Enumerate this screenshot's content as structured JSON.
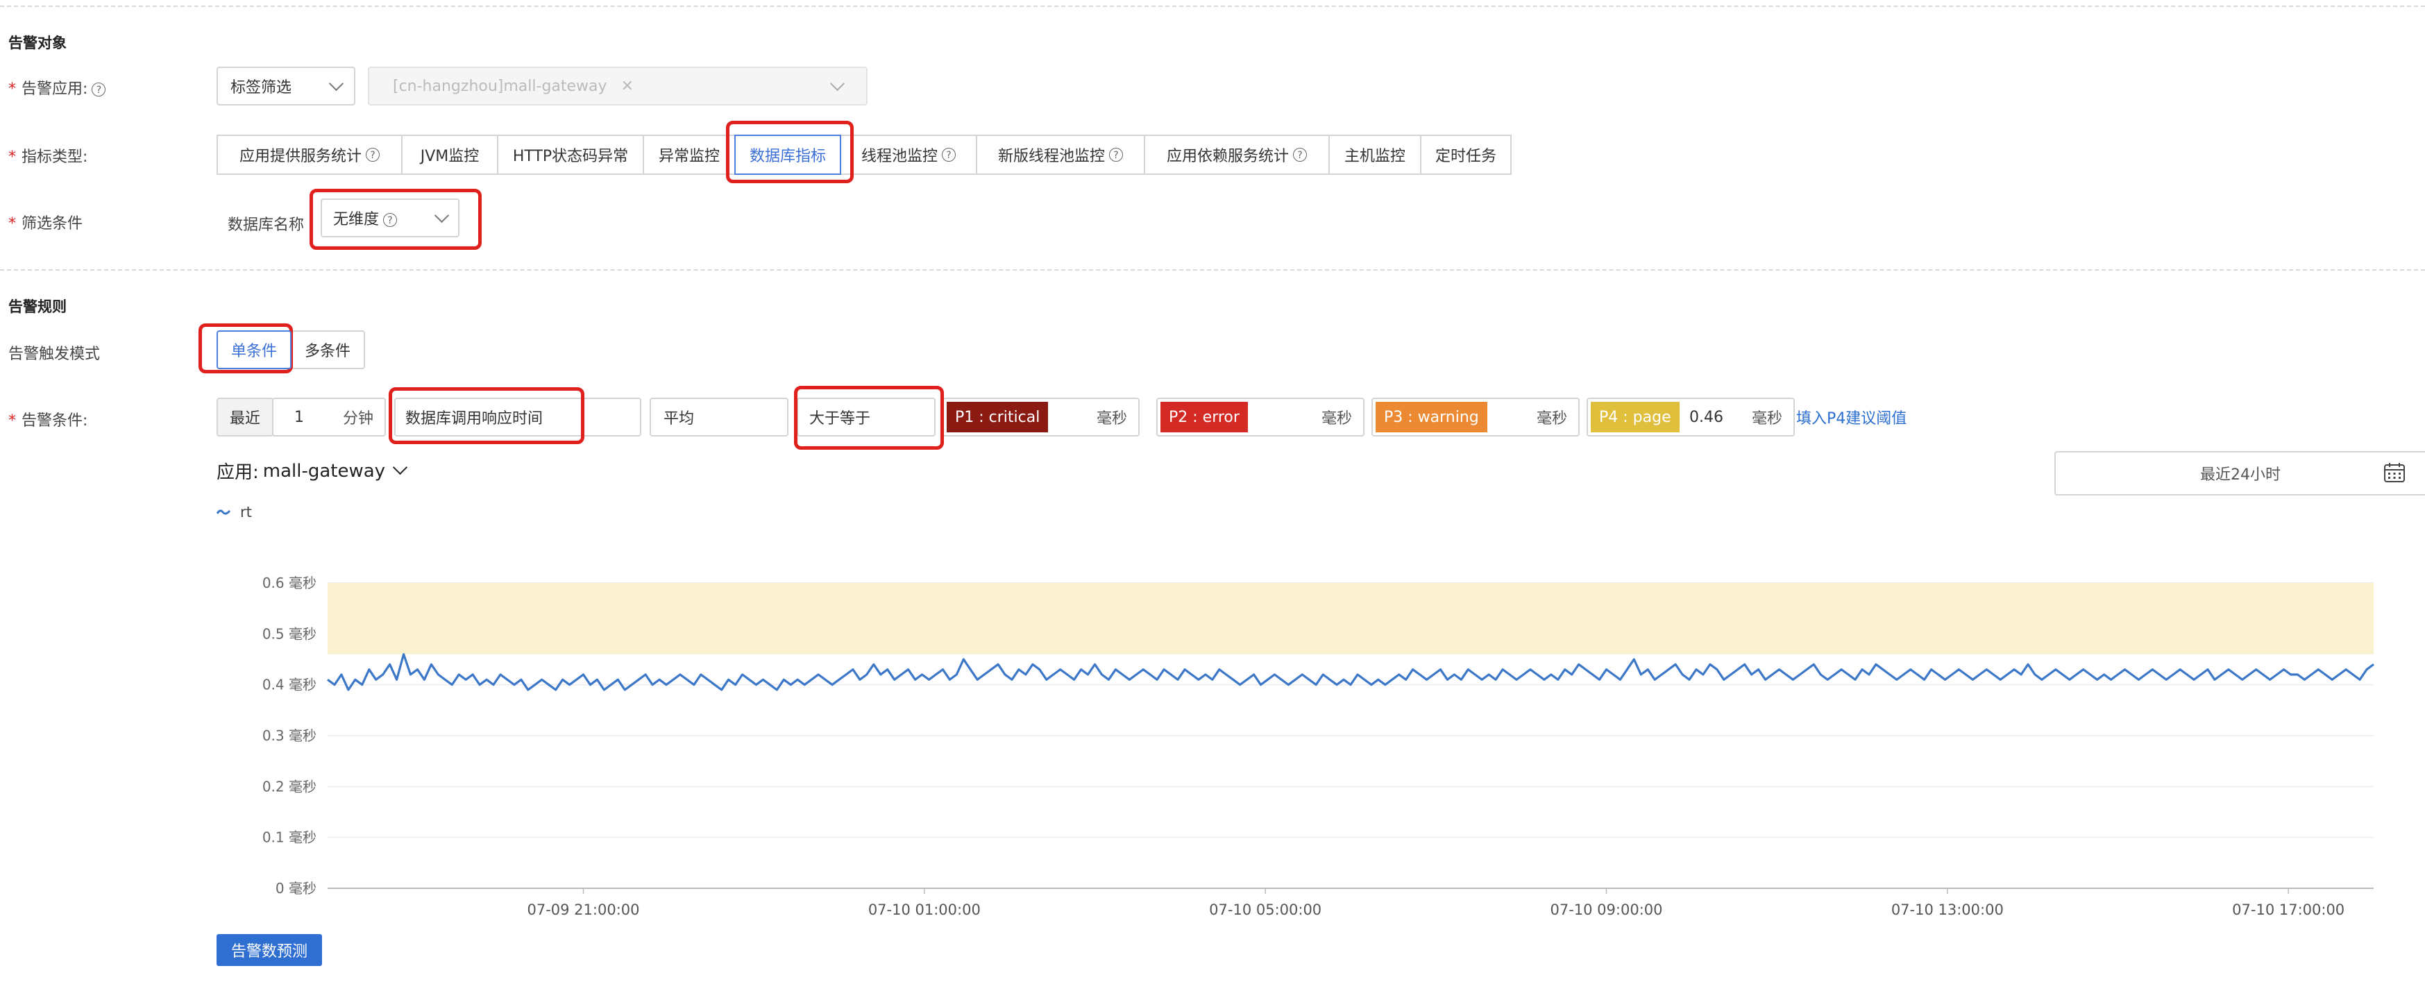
{
  "sections": {
    "target_title": "告警对象",
    "rules_title": "告警规则"
  },
  "target": {
    "app_label": "告警应用:",
    "app_selector": "标签筛选",
    "app_value": "[cn-hangzhou]mall-gateway",
    "metric_label": "指标类型:",
    "metric_tabs": [
      {
        "label": "应用提供服务统计",
        "help": true
      },
      {
        "label": "JVM监控",
        "help": false
      },
      {
        "label": "HTTP状态码异常",
        "help": false
      },
      {
        "label": "异常监控",
        "help": false
      },
      {
        "label": "数据库指标",
        "help": false,
        "active": true
      },
      {
        "label": "线程池监控",
        "help": true
      },
      {
        "label": "新版线程池监控",
        "help": true
      },
      {
        "label": "应用依赖服务统计",
        "help": true
      },
      {
        "label": "主机监控",
        "help": false
      },
      {
        "label": "定时任务",
        "help": false
      }
    ],
    "filter_label": "筛选条件",
    "filter_field": "数据库名称",
    "filter_value": "无维度"
  },
  "rules": {
    "trigger_label": "告警触发模式",
    "trigger_single": "单条件",
    "trigger_multi": "多条件",
    "condition_label": "告警条件:",
    "recent": "最近",
    "duration_value": "1",
    "duration_unit": "分钟",
    "metric": "数据库调用响应时间",
    "aggregation": "平均",
    "comparator": "大于等于",
    "severities": [
      {
        "tag": "P1 : critical",
        "color": "#8b1a12",
        "value": "",
        "unit": "毫秒"
      },
      {
        "tag": "P2 : error",
        "color": "#d42a26",
        "value": "",
        "unit": "毫秒"
      },
      {
        "tag": "P3 : warning",
        "color": "#ec8a34",
        "value": "",
        "unit": "毫秒"
      },
      {
        "tag": "P4 : page",
        "color": "#e0bf3c",
        "value": "0.46",
        "unit": "毫秒"
      }
    ],
    "fill_link": "填入P4建议阈值"
  },
  "chart_header": {
    "app_prefix": "应用:",
    "app_name": "mall-gateway",
    "time_range": "最近24小时",
    "predict_button": "告警数预测"
  },
  "chart_data": {
    "type": "line",
    "legend": [
      "rt"
    ],
    "y_unit": "毫秒",
    "ylim": [
      0,
      0.6
    ],
    "yticks": [
      "0 毫秒",
      "0.1 毫秒",
      "0.2 毫秒",
      "0.3 毫秒",
      "0.4 毫秒",
      "0.5 毫秒",
      "0.6 毫秒"
    ],
    "xticks": [
      "07-09 21:00:00",
      "07-10 01:00:00",
      "07-10 05:00:00",
      "07-10 09:00:00",
      "07-10 13:00:00",
      "07-10 17:00:00"
    ],
    "x_range": [
      "07-09 18:00",
      "07-10 18:00"
    ],
    "threshold_band": {
      "from": 0.46,
      "to": 0.6,
      "color": "#faf1d0"
    },
    "line_color": "#3d78c8",
    "series": [
      {
        "name": "rt",
        "sample_minutes": 5,
        "start": "07-09 18:00",
        "values": [
          0.41,
          0.4,
          0.42,
          0.39,
          0.41,
          0.4,
          0.43,
          0.41,
          0.42,
          0.44,
          0.41,
          0.46,
          0.42,
          0.43,
          0.41,
          0.44,
          0.42,
          0.41,
          0.4,
          0.42,
          0.41,
          0.42,
          0.4,
          0.41,
          0.4,
          0.42,
          0.41,
          0.4,
          0.41,
          0.39,
          0.4,
          0.41,
          0.4,
          0.39,
          0.41,
          0.4,
          0.41,
          0.42,
          0.4,
          0.41,
          0.39,
          0.4,
          0.41,
          0.39,
          0.4,
          0.41,
          0.42,
          0.4,
          0.41,
          0.4,
          0.41,
          0.42,
          0.41,
          0.4,
          0.42,
          0.41,
          0.4,
          0.39,
          0.41,
          0.4,
          0.42,
          0.41,
          0.4,
          0.41,
          0.4,
          0.39,
          0.41,
          0.4,
          0.41,
          0.4,
          0.41,
          0.42,
          0.41,
          0.4,
          0.41,
          0.42,
          0.43,
          0.41,
          0.42,
          0.44,
          0.42,
          0.43,
          0.41,
          0.42,
          0.43,
          0.41,
          0.42,
          0.41,
          0.42,
          0.43,
          0.41,
          0.42,
          0.45,
          0.43,
          0.41,
          0.42,
          0.43,
          0.44,
          0.42,
          0.41,
          0.43,
          0.42,
          0.44,
          0.43,
          0.41,
          0.42,
          0.43,
          0.42,
          0.41,
          0.43,
          0.42,
          0.44,
          0.42,
          0.41,
          0.43,
          0.42,
          0.41,
          0.42,
          0.43,
          0.42,
          0.41,
          0.43,
          0.42,
          0.41,
          0.43,
          0.42,
          0.41,
          0.42,
          0.41,
          0.43,
          0.42,
          0.41,
          0.4,
          0.41,
          0.42,
          0.4,
          0.41,
          0.42,
          0.41,
          0.4,
          0.41,
          0.42,
          0.41,
          0.4,
          0.42,
          0.41,
          0.4,
          0.41,
          0.4,
          0.42,
          0.41,
          0.4,
          0.41,
          0.4,
          0.41,
          0.42,
          0.41,
          0.43,
          0.42,
          0.41,
          0.42,
          0.43,
          0.41,
          0.42,
          0.41,
          0.43,
          0.42,
          0.41,
          0.42,
          0.41,
          0.43,
          0.42,
          0.41,
          0.42,
          0.43,
          0.42,
          0.41,
          0.42,
          0.41,
          0.43,
          0.42,
          0.44,
          0.43,
          0.42,
          0.41,
          0.43,
          0.42,
          0.41,
          0.43,
          0.45,
          0.42,
          0.43,
          0.41,
          0.42,
          0.43,
          0.44,
          0.42,
          0.41,
          0.43,
          0.42,
          0.44,
          0.43,
          0.41,
          0.42,
          0.43,
          0.44,
          0.42,
          0.43,
          0.41,
          0.42,
          0.43,
          0.42,
          0.41,
          0.42,
          0.43,
          0.44,
          0.42,
          0.41,
          0.42,
          0.43,
          0.42,
          0.41,
          0.43,
          0.42,
          0.44,
          0.43,
          0.42,
          0.41,
          0.42,
          0.43,
          0.42,
          0.41,
          0.43,
          0.42,
          0.41,
          0.42,
          0.43,
          0.42,
          0.41,
          0.42,
          0.43,
          0.42,
          0.41,
          0.42,
          0.43,
          0.42,
          0.44,
          0.42,
          0.41,
          0.42,
          0.43,
          0.42,
          0.41,
          0.42,
          0.43,
          0.42,
          0.41,
          0.42,
          0.41,
          0.42,
          0.43,
          0.42,
          0.41,
          0.42,
          0.43,
          0.42,
          0.41,
          0.42,
          0.43,
          0.42,
          0.41,
          0.42,
          0.43,
          0.41,
          0.42,
          0.43,
          0.42,
          0.41,
          0.42,
          0.43,
          0.42,
          0.41,
          0.42,
          0.43,
          0.42,
          0.42,
          0.41,
          0.42,
          0.43,
          0.42,
          0.41,
          0.42,
          0.43,
          0.42,
          0.41,
          0.43,
          0.44
        ]
      }
    ]
  }
}
